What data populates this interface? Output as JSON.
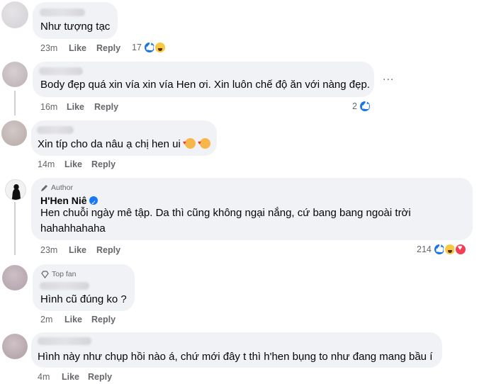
{
  "comments": [
    {
      "text": "Như tượng tạc",
      "time": "23m",
      "like": "Like",
      "reply": "Reply",
      "reaction_count": "17"
    },
    {
      "text": "Body đẹp quá xin vía xin vía Hen ơi. Xin luôn chế độ ăn với nàng đẹp.",
      "time": "16m",
      "like": "Like",
      "reply": "Reply",
      "reaction_count": "2",
      "more": "..."
    },
    {
      "text": "Xin típ cho da nâu ạ chị hen ui",
      "time": "14m",
      "like": "Like",
      "reply": "Reply"
    },
    {
      "badge": "Author",
      "name": "H'Hen Niê",
      "text_line1": "Hen chuỗi ngày mê tập. Da thì cũng không ngại nắng, cứ bang bang ngoài trời",
      "text_line2": "hahahhahaha",
      "time": "23m",
      "like": "Like",
      "reply": "Reply",
      "reaction_count": "214"
    },
    {
      "badge": "Top fan",
      "text": "Hình cũ đúng ko ?",
      "time": "2m",
      "like": "Like",
      "reply": "Reply"
    },
    {
      "text": "Hình này như chụp hồi nào á, chứ mới đây t thì h'hen bụng to như đang mang bầu í",
      "time": "4m",
      "like": "Like",
      "reply": "Reply"
    }
  ],
  "icons": {
    "like": "like-reaction-icon",
    "haha": "haha-reaction-icon",
    "love": "love-reaction-icon",
    "verified": "verified-badge-icon",
    "author": "pen-icon",
    "topfan": "diamond-icon"
  },
  "colors": {
    "bubble": "#f0f2f5",
    "meta": "#65676b",
    "like_blue": "#1877f2",
    "love_red": "#f33e58",
    "haha_yellow": "#f7c843"
  }
}
